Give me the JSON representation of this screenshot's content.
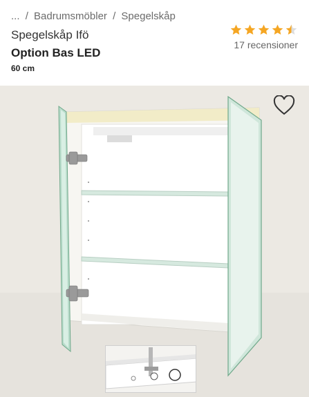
{
  "breadcrumb": {
    "items": [
      "...",
      "Badrumsmöbler",
      "Spegelskåp"
    ],
    "separator": "/"
  },
  "product": {
    "brand": "Spegelskåp Ifö",
    "title": "Option Bas LED",
    "size": "60 cm"
  },
  "rating": {
    "value": 4.5,
    "max": 5,
    "reviews_label": "17 recensioner",
    "star_color": "#f5a623"
  },
  "icons": {
    "favorite": "heart-outline-icon",
    "star": "star-icon"
  }
}
